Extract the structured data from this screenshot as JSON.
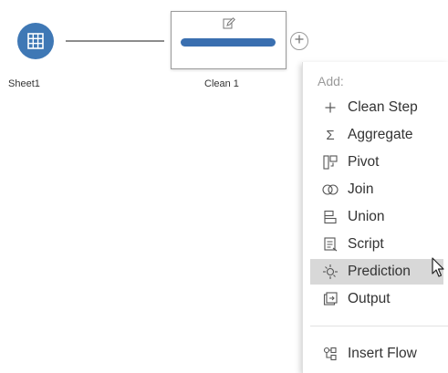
{
  "flow": {
    "input_node": {
      "label": "Sheet1"
    },
    "clean_node": {
      "label": "Clean 1"
    }
  },
  "menu": {
    "header": "Add:",
    "items": [
      {
        "label": "Clean Step",
        "icon": "plus-icon"
      },
      {
        "label": "Aggregate",
        "icon": "sigma-icon"
      },
      {
        "label": "Pivot",
        "icon": "pivot-icon"
      },
      {
        "label": "Join",
        "icon": "join-icon"
      },
      {
        "label": "Union",
        "icon": "union-icon"
      },
      {
        "label": "Script",
        "icon": "script-icon"
      },
      {
        "label": "Prediction",
        "icon": "prediction-icon",
        "highlighted": true
      },
      {
        "label": "Output",
        "icon": "output-icon"
      }
    ],
    "footer_items": [
      {
        "label": "Insert Flow",
        "icon": "insert-flow-icon"
      }
    ]
  },
  "colors": {
    "node_blue": "#3f78b5",
    "bar_blue": "#3a6fb0",
    "hover_gray": "#d8d8d8"
  }
}
